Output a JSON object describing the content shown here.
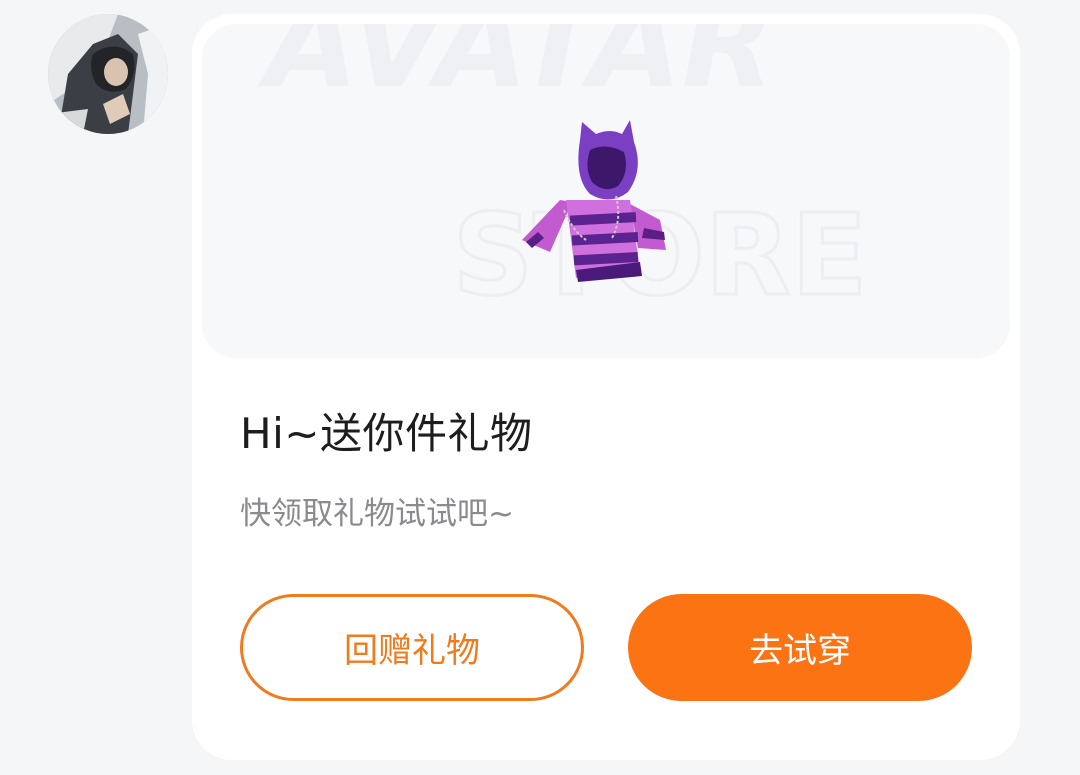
{
  "colors": {
    "page_background": "#f5f6f8",
    "card_background": "#ffffff",
    "banner_background": "#f7f8fa",
    "accent": "#fc7314",
    "outline_button_text": "#f07a1e",
    "title_text": "#1d1d1f",
    "subtitle_text": "#8a8a8f"
  },
  "sender": {
    "avatar": "user-avatar-photo"
  },
  "gift_card": {
    "banner": {
      "watermark_line1": "AVATAR",
      "watermark_line2": "STORE",
      "product_icon": "purple-cat-ear-striped-hoodie"
    },
    "title": "Hi~送你件礼物",
    "subtitle": "快领取礼物试试吧~",
    "buttons": {
      "gift_back": "回赠礼物",
      "try_on": "去试穿"
    }
  }
}
